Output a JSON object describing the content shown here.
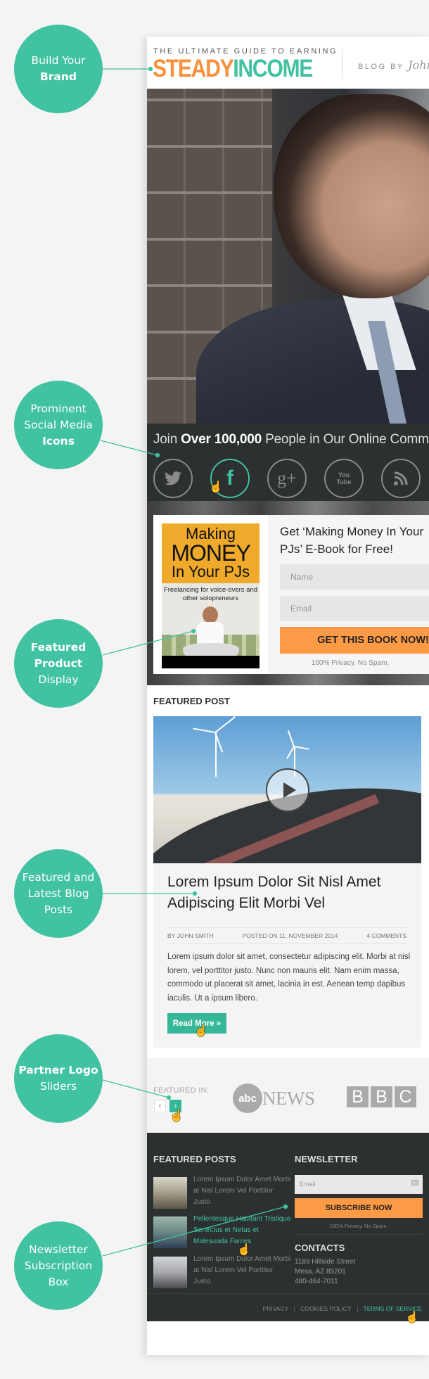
{
  "callouts": [
    {
      "plain_before": "Build Your",
      "bold": "Brand",
      "plain_after": ""
    },
    {
      "plain_before": "Prominent Social Media",
      "bold": "Icons",
      "plain_after": ""
    },
    {
      "plain_before": "",
      "bold": "Featured Product",
      "plain_after": "Display"
    },
    {
      "plain_before": "Featured and Latest Blog Posts",
      "bold": "",
      "plain_after": ""
    },
    {
      "plain_before": "",
      "bold": "Partner Logo",
      "plain_after": "Sliders"
    },
    {
      "plain_before": "Newsletter Subscription Box",
      "bold": "",
      "plain_after": ""
    }
  ],
  "header": {
    "tagline": "THE ULTIMATE GUIDE TO EARNING",
    "logo_part1": "STEADY",
    "logo_part2": "INCOME",
    "blog_by": "BLOG BY",
    "author_script": "John"
  },
  "social": {
    "join_prefix": "Join ",
    "join_bold": "Over 100,000",
    "join_suffix": " People in Our Online Community",
    "icons": [
      {
        "name": "twitter-icon",
        "glyph": "🐦",
        "active": false
      },
      {
        "name": "facebook-icon",
        "glyph": "f",
        "active": true
      },
      {
        "name": "google-plus-icon",
        "glyph": "g+",
        "active": false
      },
      {
        "name": "youtube-icon",
        "glyph": "You Tube",
        "active": false
      },
      {
        "name": "rss-icon",
        "glyph": "◝",
        "active": false
      }
    ]
  },
  "optin": {
    "book_title_1": "Making",
    "book_title_2": "MONEY",
    "book_title_3": "In Your PJs",
    "book_subtitle": "Freelancing for voice-overs and other solopreneurs",
    "title_line1": "Get ‘Making Money In Your",
    "title_line2": "PJs’ E-Book for Free!",
    "name_placeholder": "Name",
    "email_placeholder": "Email",
    "cta_label": "GET THIS BOOK NOW!",
    "privacy": "100% Privacy. No Spam."
  },
  "featured_post": {
    "section_label": "FEATURED POST",
    "title": "Lorem Ipsum Dolor Sit Nisl Amet Adipiscing Elit Morbi Vel",
    "author": "BY JOHN SMITH",
    "posted": "POSTED ON 11, NOVEMBER 2014",
    "comments": "4 COMMENTS",
    "body": "Lorem ipsum dolor sit amet, consectetur adipiscing elit. Morbi at nisl lorem, vel porttitor justo. Nunc non mauris elit. Nam enim massa, commodo ut placerat sit amet, lacinia in est. Aenean temp dapibus iaculis. Ut a ipsum libero.",
    "read_more": "Read More »"
  },
  "partners": {
    "label": "FEATURED IN:",
    "prev": "‹",
    "next": "›",
    "abc_ball": "abc",
    "abc_news": "NEWS",
    "bbc": [
      "B",
      "B",
      "C"
    ]
  },
  "footer": {
    "featured_posts_heading": "FEATURED POSTS",
    "featured_posts": [
      {
        "text": "Lorem Ipsum Dolor Amet Morbi at Nisl Lorem Vel Porttitor Justo",
        "active": false
      },
      {
        "text": "Pellentesque Habitant Tristique Senectus et Netus et Malesuada Fames",
        "active": true
      },
      {
        "text": "Lorem Ipsum Dolor Amet Morbi at Nisl Lorem Vel Porttitor Justo.",
        "active": false
      }
    ],
    "newsletter_heading": "NEWSLETTER",
    "email_placeholder": "Email",
    "subscribe_label": "SUBSCRIBE NOW",
    "privacy": "100% Privacy. No Spam.",
    "contacts_heading": "CONTACTS",
    "address_line1": "1189 Hillside Street",
    "address_line2": "Mesa, AZ 85201",
    "phone": "480-464-7011",
    "links": [
      "PRIVACY",
      "COOKIES POLICY",
      "TERMS OF SERVICE"
    ]
  },
  "colors": {
    "accent": "#41c2a0",
    "orange": "#f7913d",
    "dark": "#2c3030"
  }
}
